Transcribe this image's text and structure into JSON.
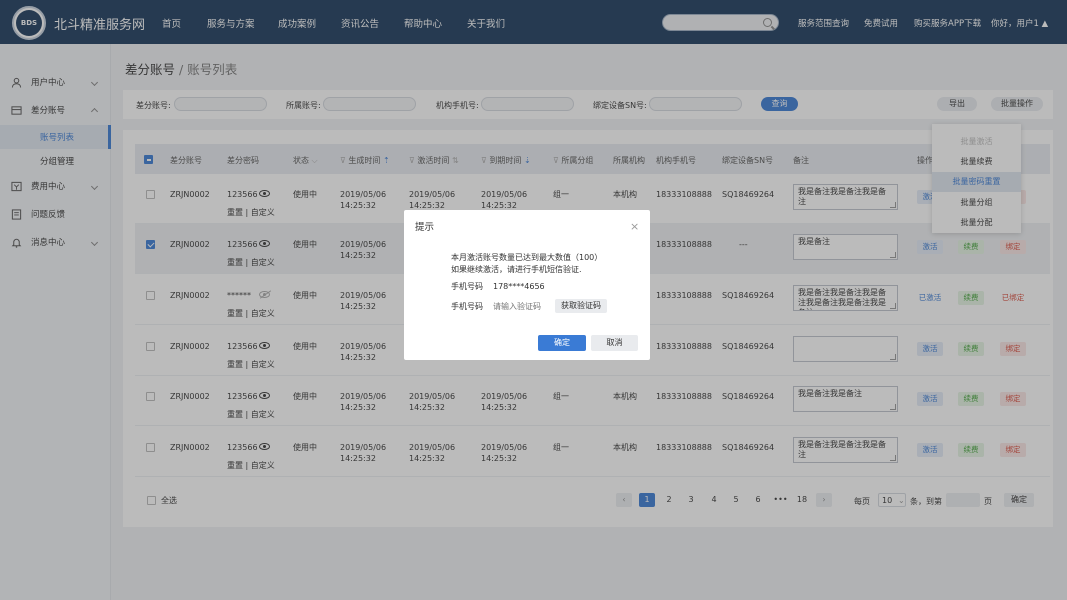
{
  "header": {
    "logo_text": "BDS",
    "brand": "北斗精准服务网",
    "nav": [
      "首页",
      "服务与方案",
      "成功案例",
      "资讯公告",
      "帮助中心",
      "关于我们"
    ],
    "search_placeholder": "",
    "links": [
      "服务范围查询",
      "免费试用",
      "购买服务APP下载"
    ],
    "user": "你好，用户1"
  },
  "sidebar": {
    "items": [
      {
        "label": "用户中心",
        "icon": "user-icon"
      },
      {
        "label": "差分账号",
        "icon": "account-icon"
      },
      {
        "label": "费用中心",
        "icon": "billing-icon"
      },
      {
        "label": "问题反馈",
        "icon": "feedback-icon"
      },
      {
        "label": "消息中心",
        "icon": "bell-icon"
      }
    ],
    "sub": [
      "账号列表",
      "分组管理"
    ]
  },
  "breadcrumb": {
    "parent": "差分账号",
    "sep": "/",
    "current": "账号列表"
  },
  "filters": {
    "account_label": "差分账号:",
    "owner_label": "所属账号:",
    "phone_label": "机构手机号:",
    "sn_label": "绑定设备SN号:",
    "query": "查询",
    "export": "导出",
    "batch": "批量操作"
  },
  "batch_menu": [
    "批量激活",
    "批量续费",
    "批量密码重置",
    "批量分组",
    "批量分配"
  ],
  "table": {
    "headers": [
      "差分账号",
      "差分密码",
      "状态",
      "生成时间",
      "激活时间",
      "到期时间",
      "所属分组",
      "所属机构",
      "机构手机号",
      "绑定设备SN号",
      "备注",
      "操作"
    ],
    "rows": [
      {
        "account": "ZRJN0002",
        "password": "123566",
        "pw_actions": "重置 | 自定义",
        "status": "使用中",
        "created": "2019/05/06 14:25:32",
        "activated": "2019/05/06 14:25:32",
        "expires": "2019/05/06 14:25:32",
        "group": "组一",
        "org": "本机构",
        "phone": "18333108888",
        "sn": "SQ18469264",
        "note": "我是备注我是备注我是备注",
        "act1": "激活",
        "act2": "续费",
        "act3": "绑定"
      },
      {
        "account": "ZRJN0002",
        "password": "123566",
        "pw_actions": "重置 | 自定义",
        "status": "使用中",
        "created": "2019/05/06 14:25:32",
        "activated": "",
        "expires": "",
        "group": "",
        "org": "",
        "phone": "18333108888",
        "sn": "---",
        "note": "我是备注",
        "act1": "激活",
        "act2": "续费",
        "act3": "绑定"
      },
      {
        "account": "ZRJN0002",
        "password": "******",
        "pw_actions": "重置 | 自定义",
        "status": "使用中",
        "created": "2019/05/06 14:25:32",
        "activated": "",
        "expires": "",
        "group": "",
        "org": "",
        "phone": "18333108888",
        "sn": "SQ18469264",
        "note": "我是备注我是备注我是备注我是备注我是备注我是备注",
        "act1": "已激活",
        "act2": "续费",
        "act3": "已绑定"
      },
      {
        "account": "ZRJN0002",
        "password": "123566",
        "pw_actions": "重置 | 自定义",
        "status": "使用中",
        "created": "2019/05/06 14:25:32",
        "activated": "",
        "expires": "",
        "group": "",
        "org": "",
        "phone": "18333108888",
        "sn": "SQ18469264",
        "note": "",
        "act1": "激活",
        "act2": "续费",
        "act3": "绑定"
      },
      {
        "account": "ZRJN0002",
        "password": "123566",
        "pw_actions": "重置 | 自定义",
        "status": "使用中",
        "created": "2019/05/06 14:25:32",
        "activated": "2019/05/06 14:25:32",
        "expires": "2019/05/06 14:25:32",
        "group": "组一",
        "org": "本机构",
        "phone": "18333108888",
        "sn": "SQ18469264",
        "note": "我是备注我是备注",
        "act1": "激活",
        "act2": "续费",
        "act3": "绑定"
      },
      {
        "account": "ZRJN0002",
        "password": "123566",
        "pw_actions": "重置 | 自定义",
        "status": "使用中",
        "created": "2019/05/06 14:25:32",
        "activated": "2019/05/06 14:25:32",
        "expires": "2019/05/06 14:25:32",
        "group": "组一",
        "org": "本机构",
        "phone": "18333108888",
        "sn": "SQ18469264",
        "note": "我是备注我是备注我是备注",
        "act1": "激活",
        "act2": "续费",
        "act3": "绑定"
      }
    ],
    "select_all": "全选"
  },
  "pagination": {
    "pages": [
      "1",
      "2",
      "3",
      "4",
      "5",
      "6",
      "•••",
      "18"
    ],
    "per_page_label": "每页",
    "per_page": "10",
    "unit": "条，到第",
    "page_unit": "页",
    "confirm": "确定"
  },
  "modal": {
    "title": "提示",
    "message1": "本月激活账号数量已达到最大数值（100）",
    "message2": "如果继续激活，请进行手机短信验证.",
    "phone_label": "手机号码",
    "phone_value": "178****4656",
    "code_label": "手机号码",
    "code_placeholder": "请输入验证码",
    "get_code": "获取验证码",
    "ok": "确定",
    "cancel": "取消"
  },
  "colors": {
    "nav_bg": "#1b3a5c",
    "accent": "#3a7bd5",
    "green": "#44a53b",
    "red": "#d94a3b"
  }
}
